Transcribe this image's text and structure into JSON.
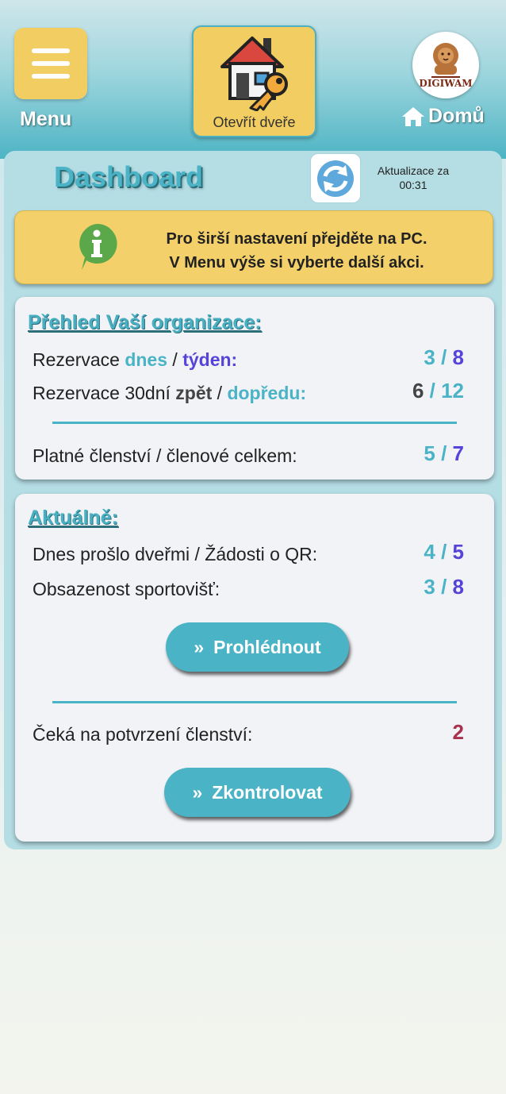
{
  "header": {
    "menu_label": "Menu",
    "door_label": "Otevřít dveře",
    "logo_text": "DIGIWAM",
    "home_label": "Domů"
  },
  "dashboard": {
    "title": "Dashboard",
    "refresh_label": "Aktualizace za",
    "refresh_time": "00:31"
  },
  "info": {
    "line1": "Pro širší nastavení přejděte na PC.",
    "line2": "V Menu výše si vyberte další akci."
  },
  "overview": {
    "title": "Přehled Vaší organizace:",
    "row1": {
      "label_a": "Rezervace ",
      "label_b": "dnes",
      "label_c": " / ",
      "label_d": "týden:",
      "value_a": "3",
      "sep": " / ",
      "value_b": "8"
    },
    "row2": {
      "label_a": "Rezervace 30dní ",
      "label_b": "zpět",
      "label_c": " / ",
      "label_d": "dopředu:",
      "value_a": "6",
      "sep": " / ",
      "value_b": "12"
    },
    "row3": {
      "label": "Platné členství / členové celkem:",
      "value_a": "5",
      "sep": " / ",
      "value_b": "7"
    }
  },
  "current": {
    "title": "Aktuálně:",
    "row1": {
      "label": "Dnes prošlo dveřmi / Žádosti o QR:",
      "value_a": "4",
      "sep": " / ",
      "value_b": "5"
    },
    "row2": {
      "label": "Obsazenost sportovišť:",
      "value_a": "3",
      "sep": " / ",
      "value_b": "8"
    },
    "view_button": "Prohlédnout",
    "row3": {
      "label": "Čeká na potvrzení členství:",
      "value": "2"
    },
    "check_button": "Zkontrolovat",
    "button_glyph": "»"
  },
  "colors": {
    "accent_teal": "#4ab3c6",
    "accent_purple": "#5643d8",
    "warning_yellow": "#f3d06a",
    "pending_red": "#a8324d"
  },
  "icons": [
    "hamburger-icon",
    "house-key-icon",
    "lion-logo-icon",
    "home-icon",
    "refresh-icon",
    "info-icon",
    "double-chevron-right-icon"
  ]
}
